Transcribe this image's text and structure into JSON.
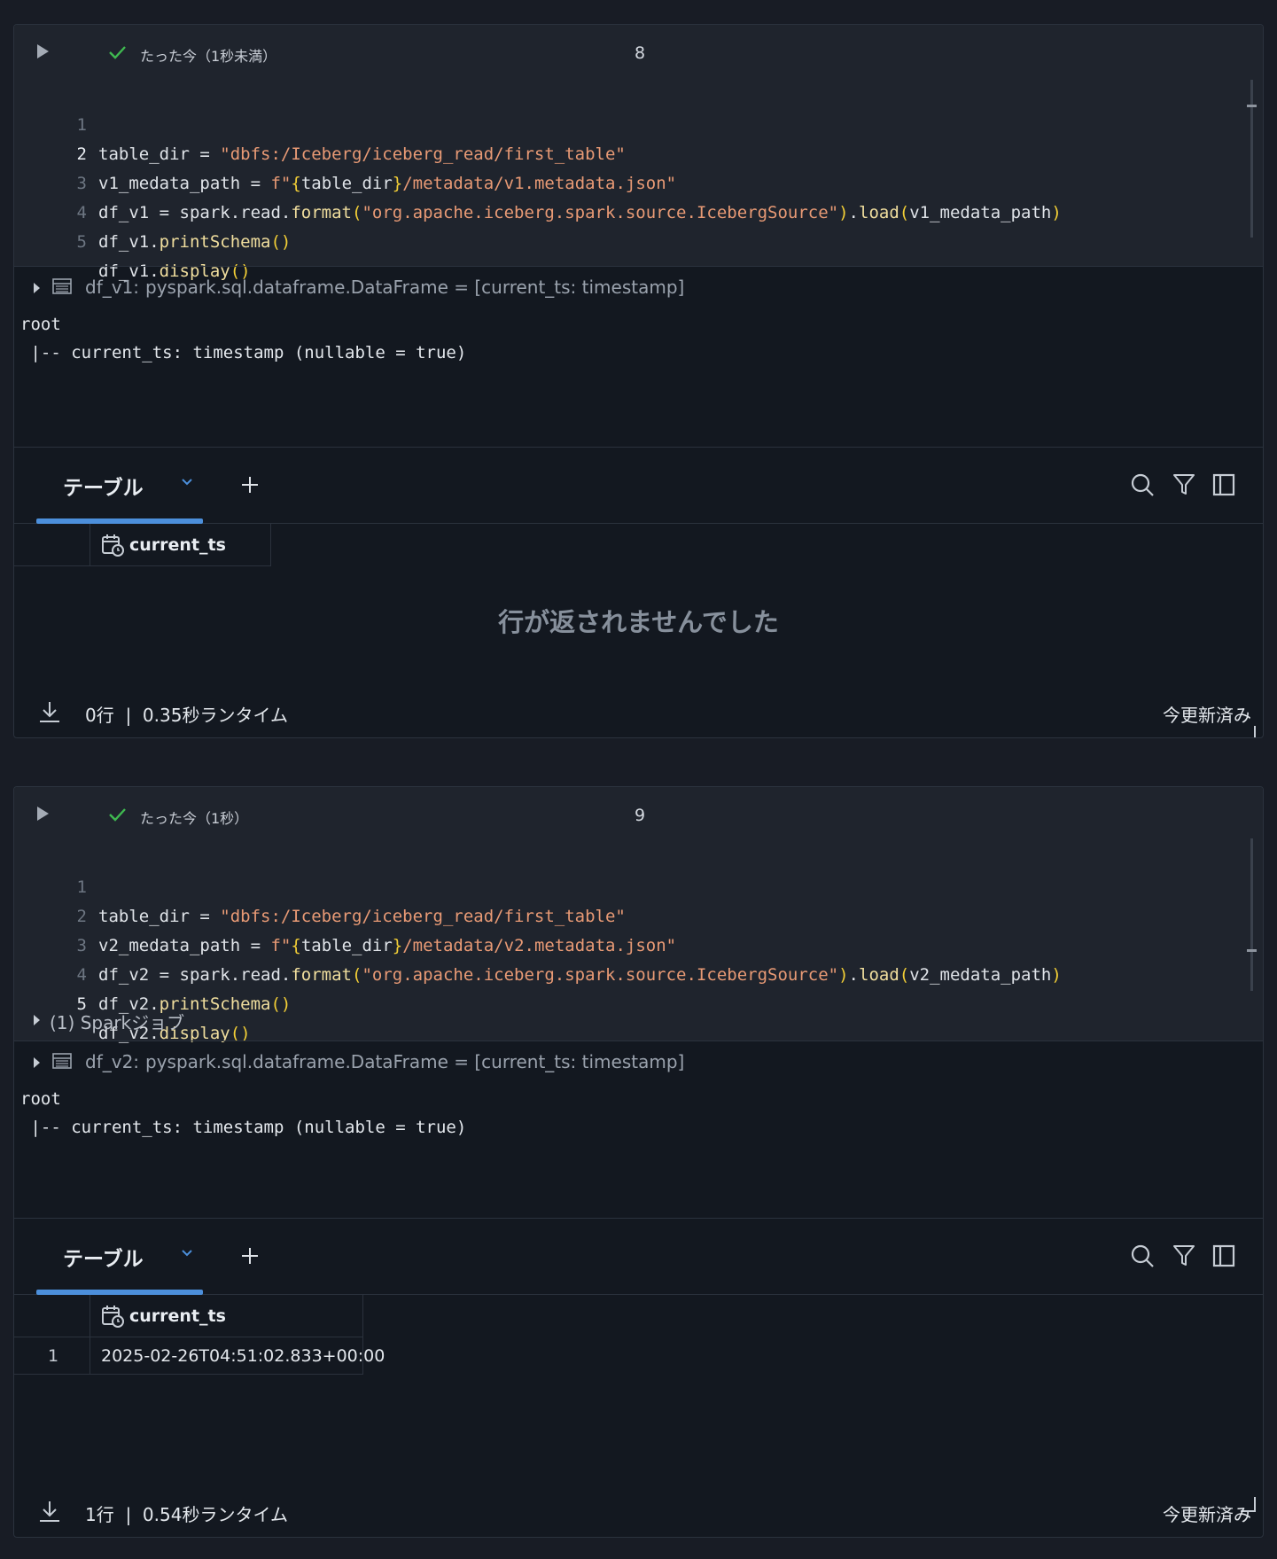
{
  "cells": [
    {
      "status": "たった今（1秒未満）",
      "cell_number": "8",
      "code_lines": [
        {
          "num": "1"
        },
        {
          "num": "2"
        },
        {
          "num": "3"
        },
        {
          "num": "4"
        },
        {
          "num": "5"
        }
      ],
      "code": {
        "l1_var": "table_dir",
        "l1_eq": " = ",
        "l1_str": "\"dbfs:/Iceberg/iceberg_read/first_table\"",
        "l2_var": "v1_medata_path",
        "l2_eq": " = ",
        "l2_f": "f\"",
        "l2_brace_open": "{",
        "l2_inner": "table_dir",
        "l2_brace_close": "}",
        "l2_rest": "/metadata/v1.metadata.json\"",
        "l3_var": "df_v1",
        "l3_eq": " = spark.read.",
        "l3_fn": "format",
        "l3_p1": "(",
        "l3_str": "\"org.apache.iceberg.spark.source.IcebergSource\"",
        "l3_p2": ")",
        "l3_dot": ".",
        "l3_fn2": "load",
        "l3_p3": "(",
        "l3_arg": "v1_medata_path",
        "l3_p4": ")",
        "l4_var": "df_v1.",
        "l4_fn": "printSchema",
        "l4_p": "()",
        "l5_var": "df_v1.",
        "l5_fn": "display",
        "l5_p": "()"
      },
      "spark_jobs": "",
      "df_name": "df_v1:",
      "df_type": "pyspark.sql.dataframe.DataFrame = [current_ts: timestamp]",
      "schema_root": "root",
      "schema_field": " |-- current_ts: timestamp (nullable = true)",
      "tab_label": "テーブル",
      "column": "current_ts",
      "empty_message": "行が返されませんでした",
      "rows": [],
      "footer_rows": "0行",
      "footer_sep": "|",
      "footer_runtime": "0.35秒ランタイム",
      "footer_updated": "今更新済み"
    },
    {
      "status": "たった今（1秒）",
      "cell_number": "9",
      "code": {
        "l1_var": "table_dir",
        "l1_eq": " = ",
        "l1_str": "\"dbfs:/Iceberg/iceberg_read/first_table\"",
        "l2_var": "v2_medata_path",
        "l2_eq": " = ",
        "l2_f": "f\"",
        "l2_brace_open": "{",
        "l2_inner": "table_dir",
        "l2_brace_close": "}",
        "l2_rest": "/metadata/v2.metadata.json\"",
        "l3_var": "df_v2",
        "l3_eq": " = spark.read.",
        "l3_fn": "format",
        "l3_p1": "(",
        "l3_str": "\"org.apache.iceberg.spark.source.IcebergSource\"",
        "l3_p2": ")",
        "l3_dot": ".",
        "l3_fn2": "load",
        "l3_p3": "(",
        "l3_arg": "v2_medata_path",
        "l3_p4": ")",
        "l4_var": "df_v2.",
        "l4_fn": "printSchema",
        "l4_p": "()",
        "l5_var": "df_v2.",
        "l5_fn": "display",
        "l5_p": "()"
      },
      "spark_jobs": "(1) Sparkジョブ",
      "df_name": "df_v2:",
      "df_type": "pyspark.sql.dataframe.DataFrame = [current_ts: timestamp]",
      "schema_root": "root",
      "schema_field": " |-- current_ts: timestamp (nullable = true)",
      "tab_label": "テーブル",
      "column": "current_ts",
      "rows": [
        {
          "index": "1",
          "current_ts": "2025-02-26T04:51:02.833+00:00"
        }
      ],
      "footer_rows": "1行",
      "footer_sep": "|",
      "footer_runtime": "0.54秒ランタイム",
      "footer_updated": "今更新済み"
    }
  ],
  "line_numbers": [
    "1",
    "2",
    "3",
    "4",
    "5"
  ],
  "colors": {
    "accent": "#4c8fdb",
    "success": "#3fb950",
    "string": "#e89a75",
    "function": "#f0de9e",
    "brace": "#f3cf36"
  },
  "icons": [
    "run-icon",
    "check-icon",
    "table-icon",
    "chevron-down-icon",
    "plus-icon",
    "search-icon",
    "filter-icon",
    "sidebar-icon",
    "calendar-clock-icon",
    "download-icon",
    "resize-icon"
  ]
}
